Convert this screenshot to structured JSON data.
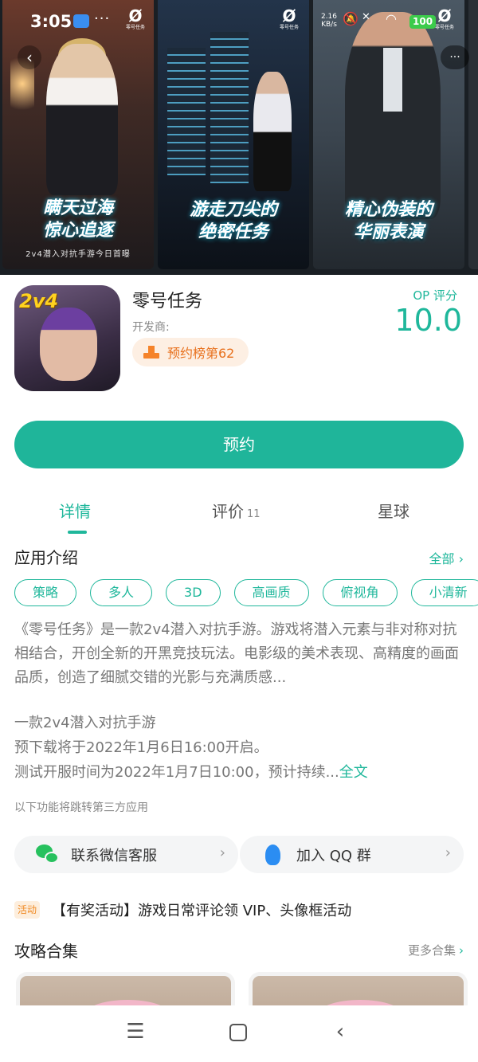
{
  "status_bar": {
    "time": "3:05",
    "more": "···",
    "net_speed": "2.16\nKB/s",
    "battery": "100"
  },
  "banner": {
    "logo": "Ø",
    "logo_sub": "零号任务",
    "screens": [
      {
        "slogan_line1": "瞒天过海",
        "slogan_line2": "惊心追逐",
        "tagline": "2v4潜入对抗手游今日首曝"
      },
      {
        "slogan_line1": "游走刀尖的",
        "slogan_line2": "绝密任务"
      },
      {
        "slogan_line1": "精心伪装的",
        "slogan_line2": "华丽表演"
      }
    ],
    "back_icon": "‹",
    "more_icon": "···"
  },
  "app": {
    "icon_badge": "2v4",
    "name": "零号任务",
    "developer_label": "开发商:",
    "rank_text": "预约榜第62",
    "score_label": "OP 评分",
    "score": "10.0"
  },
  "reserve_button": "预约",
  "tabs": [
    {
      "label": "详情",
      "count": ""
    },
    {
      "label": "评价",
      "count": "11"
    },
    {
      "label": "星球",
      "count": ""
    }
  ],
  "intro": {
    "title": "应用介绍",
    "all_link": "全部",
    "tags": [
      "策略",
      "多人",
      "3D",
      "高画质",
      "俯视角",
      "小清新"
    ],
    "description": "《零号任务》是一款2v4潜入对抗手游。游戏将潜入元素与非对称对抗相结合，开创全新的开黑竞技玩法。电影级的美术表现、高精度的画面品质，创造了细腻交错的光影与充满质感...",
    "line1": "一款2v4潜入对抗手游",
    "line2": "预下载将于2022年1月6日16:00开启。",
    "line3": "测试开服时间为2022年1月7日10:00，预计持续...",
    "full_link": "全文",
    "third_party_note": "以下功能将跳转第三方应用"
  },
  "services": {
    "wechat_label": "联系微信客服",
    "qq_label": "加入 QQ 群"
  },
  "activity": {
    "tag": "活动",
    "text": "【有奖活动】游戏日常评论领 VIP、头像框活动"
  },
  "guides": {
    "title": "攻略合集",
    "more_link": "更多合集"
  },
  "colors": {
    "accent": "#1fb79b",
    "rank_orange": "#e8701c",
    "wechat_green": "#27c15e",
    "qq_blue": "#2b8df2"
  }
}
